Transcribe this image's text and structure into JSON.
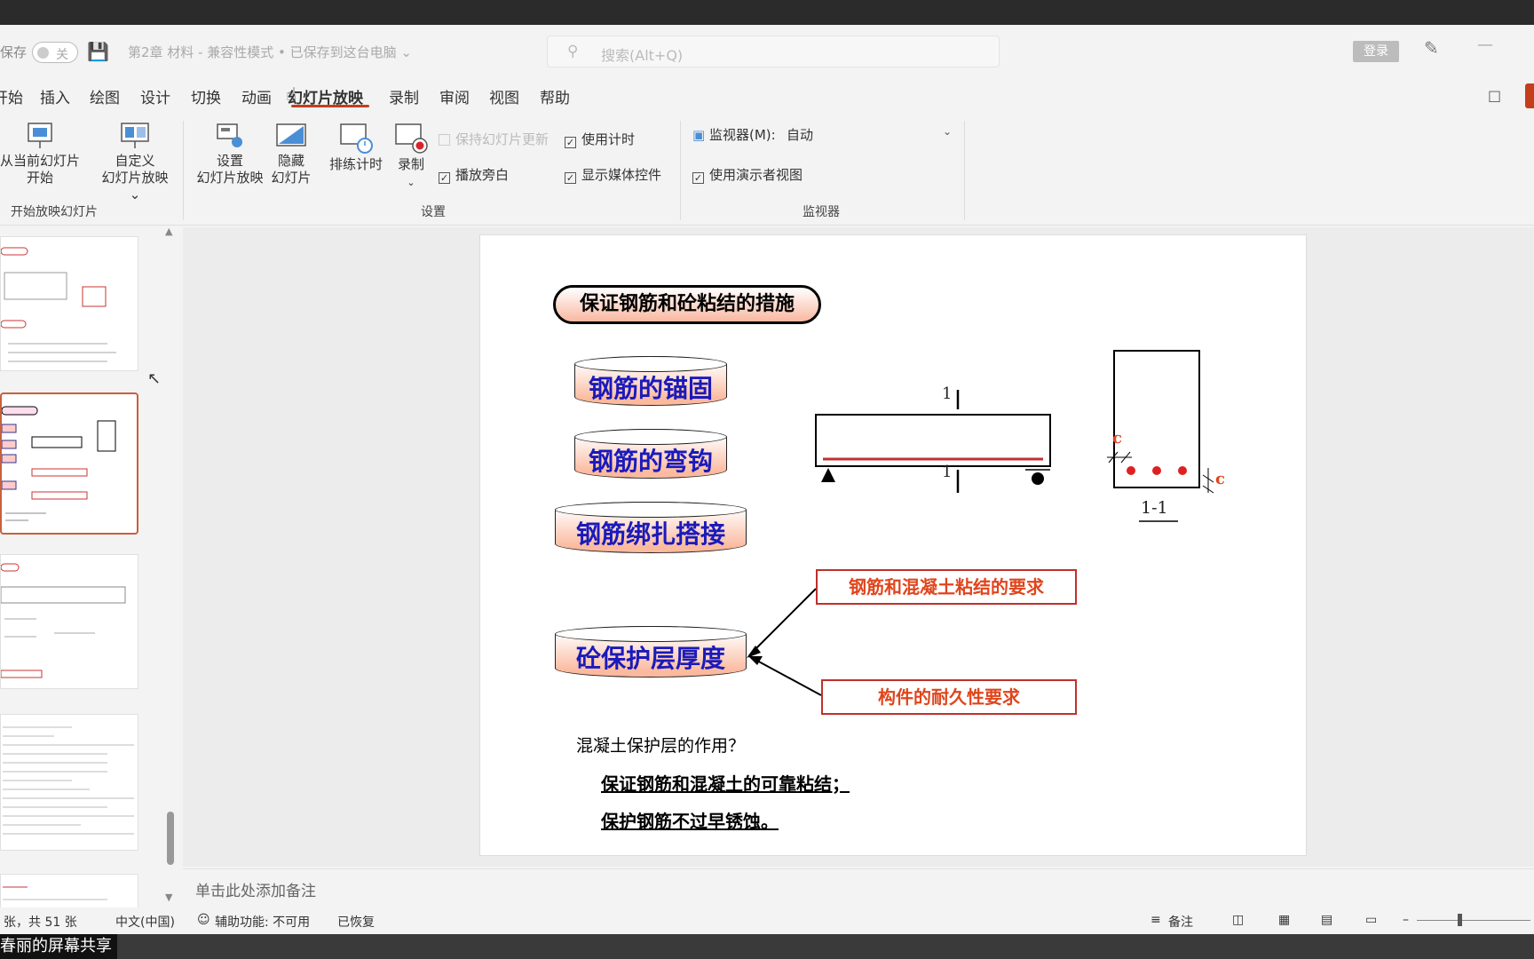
{
  "titlebar": {
    "autosave_label": "保存",
    "toggle_state": "关",
    "document_title": "第2章  材料  -  兼容性模式 • 已保存到这台电脑 ⌄",
    "search_placeholder": "搜索(Alt+Q)",
    "login_label": "登录"
  },
  "tabs": [
    "开始",
    "插入",
    "绘图",
    "设计",
    "切换",
    "动画",
    "幻灯片放映",
    "录制",
    "审阅",
    "视图",
    "帮助"
  ],
  "active_tab": "幻灯片放映",
  "ribbon": {
    "from_current_line1": "从当前幻灯片",
    "from_current_line2": "开始",
    "custom_line1": "自定义",
    "custom_line2": "幻灯片放映 ⌄",
    "group_start_label": "开始放映幻灯片",
    "setup_line1": "设置",
    "setup_line2": "幻灯片放映",
    "hide_line1": "隐藏",
    "hide_line2": "幻灯片",
    "rehearse_label": "排练计时",
    "record_label": "录制",
    "keep_updated": "保持幻灯片更新",
    "use_timings": "使用计时",
    "play_narration": "播放旁白",
    "show_media_controls": "显示媒体控件",
    "group_setup_label": "设置",
    "monitor_label": "监视器(M):",
    "monitor_value": "自动",
    "use_presenter_view": "使用演示者视图",
    "group_monitor_label": "监视器"
  },
  "slide": {
    "title": "保证钢筋和砼粘结的措施",
    "items": [
      "钢筋的锚固",
      "钢筋的弯钩",
      "钢筋绑扎搭接",
      "砼保护层厚度"
    ],
    "requirement_bond": "钢筋和混凝土粘结的要求",
    "requirement_durability": "构件的耐久性要求",
    "section_mark_top": "1",
    "section_mark_bottom": "1",
    "cover_label_left": "c",
    "cover_label_right": "c",
    "section_label": "1-1",
    "question": "混凝土保护层的作用？",
    "answer1": "保证钢筋和混凝土的可靠粘结；",
    "answer2": "保护钢筋不过早锈蚀。"
  },
  "notes_placeholder": "单击此处添加备注",
  "status": {
    "slide_count": "张，共 51 张",
    "language": "中文(中国)",
    "accessibility": "辅助功能: 不可用",
    "recovered": "已恢复",
    "notes_button": "备注"
  },
  "share_label": "春丽的屏幕共享",
  "colors": {
    "accent": "#c43e1c",
    "rebar_red": "#c0302c",
    "cylinder_text": "#1a1abb",
    "requirement_text": "#e0451c"
  }
}
